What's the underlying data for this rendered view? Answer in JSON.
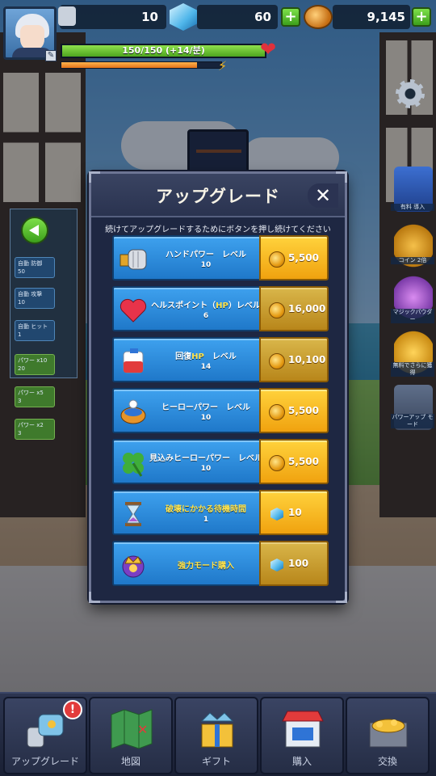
{
  "hud": {
    "attempts": "10",
    "gems": "60",
    "coins": "9,145",
    "hp_text": "150/150 (+14/분)",
    "hp_fraction": 1.0,
    "xp_fraction": 0.85
  },
  "modal": {
    "title": "アップグレード",
    "close_icon": "close-icon",
    "hint": "続けてアップグレードするためにボタンを押し続けてください",
    "rows": [
      {
        "name": "ハンドパワー　レベル",
        "level": "10",
        "cost": "5,500",
        "currency": "coin",
        "icon": "fist-icon"
      },
      {
        "name_pre": "ヘルスポイント（",
        "name_hl": "HP",
        "name_post": "）レベル",
        "level": "6",
        "cost": "16,000",
        "currency": "coin",
        "icon": "heart-icon"
      },
      {
        "name_pre": "回復",
        "name_hl": "HP",
        "name_post": "　レベル",
        "level": "14",
        "cost": "10,100",
        "currency": "coin",
        "icon": "potion-icon"
      },
      {
        "name": "ヒーローパワー　レベル",
        "level": "10",
        "cost": "5,500",
        "currency": "coin",
        "icon": "bowl-icon"
      },
      {
        "name": "見込みヒーローパワー　レベル",
        "level": "10",
        "cost": "5,500",
        "currency": "coin",
        "icon": "clover-icon"
      },
      {
        "name": "破壊にかかる待機時間",
        "level": "1",
        "cost": "10",
        "currency": "gem",
        "icon": "hourglass-icon"
      },
      {
        "name": "強力モード購入",
        "level": "",
        "cost": "100",
        "currency": "gem",
        "icon": "crown-icon"
      }
    ]
  },
  "side": {
    "tiles": [
      {
        "l1": "自動 防御",
        "l2": "50"
      },
      {
        "l1": "自動 攻撃",
        "l2": "10"
      },
      {
        "l1": "自動 ヒット",
        "l2": "1"
      },
      {
        "l1": "パワー x10",
        "l2": "20"
      },
      {
        "l1": "パワー x5",
        "l2": "3"
      },
      {
        "l1": "パワー x2",
        "l2": "3"
      }
    ],
    "right_labels": [
      "有料 導入",
      "コイン 2倍",
      "マジックパウダー",
      "無料でさらに獲得",
      "パワーアップ モード"
    ]
  },
  "nav": {
    "items": [
      {
        "label": "アップグレード",
        "icon": "gauntlet-icon"
      },
      {
        "label": "地図",
        "icon": "map-icon"
      },
      {
        "label": "ギフト",
        "icon": "gift-icon"
      },
      {
        "label": "購入",
        "icon": "shop-icon"
      },
      {
        "label": "交換",
        "icon": "treasure-icon"
      }
    ],
    "upgrade_badge": "!"
  },
  "colors": {
    "row_blue": "#2b8fe0",
    "cost_gold": "#f5b522",
    "hp_green": "#6cc934",
    "panel_dark": "#1e2742"
  }
}
